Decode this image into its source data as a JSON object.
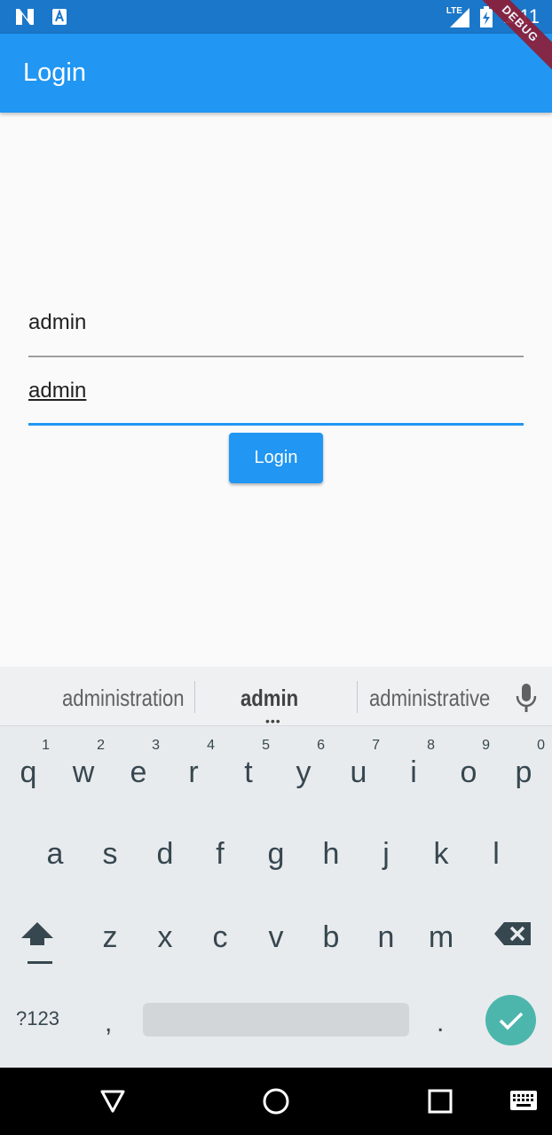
{
  "status_bar": {
    "time": "1:11",
    "network_label": "LTE",
    "debug_banner": "DEBUG"
  },
  "app_bar": {
    "title": "Login"
  },
  "form": {
    "username_value": "admin",
    "password_value": "admin",
    "login_button_label": "Login"
  },
  "keyboard": {
    "suggestions": [
      "administration",
      "admin",
      "administrative"
    ],
    "row1": [
      {
        "key": "q",
        "hint": "1"
      },
      {
        "key": "w",
        "hint": "2"
      },
      {
        "key": "e",
        "hint": "3"
      },
      {
        "key": "r",
        "hint": "4"
      },
      {
        "key": "t",
        "hint": "5"
      },
      {
        "key": "y",
        "hint": "6"
      },
      {
        "key": "u",
        "hint": "7"
      },
      {
        "key": "i",
        "hint": "8"
      },
      {
        "key": "o",
        "hint": "9"
      },
      {
        "key": "p",
        "hint": "0"
      }
    ],
    "row2": [
      "a",
      "s",
      "d",
      "f",
      "g",
      "h",
      "j",
      "k",
      "l"
    ],
    "row3": [
      "z",
      "x",
      "c",
      "v",
      "b",
      "n",
      "m"
    ],
    "symbols_key": "?123",
    "comma_key": ",",
    "period_key": "."
  },
  "colors": {
    "primary": "#2196F3",
    "status_bar": "#1A77C9",
    "enter_key": "#4DB6AC",
    "debug_banner": "#8E1E38"
  }
}
